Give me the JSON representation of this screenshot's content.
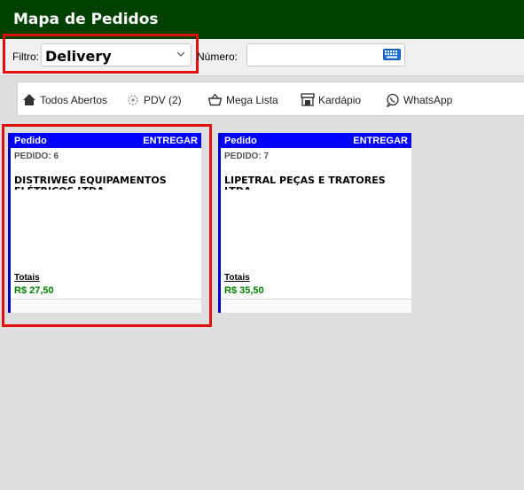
{
  "app": {
    "title": "Mapa de Pedidos"
  },
  "filter": {
    "label": "Filtro:",
    "value": "Delivery"
  },
  "numero": {
    "label": "Número:",
    "value": ""
  },
  "toolbar": {
    "todos_abertos": "Todos Abertos",
    "pdv": "PDV (2)",
    "mega_lista": "Mega Lista",
    "kardapio": "Kardápio",
    "whatsapp": "WhatsApp"
  },
  "orders": [
    {
      "header_left": "Pedido",
      "header_right": "ENTREGAR",
      "pedido": "PEDIDO: 6",
      "cliente": "DISTRIWEG EQUIPAMENTOS ELÉTRICOS LTDA",
      "totais_label": "Totais",
      "total": "R$ 27,50"
    },
    {
      "header_left": "Pedido",
      "header_right": "ENTREGAR",
      "pedido": "PEDIDO: 7",
      "cliente": "LIPETRAL PEÇAS E TRATORES LTDA",
      "totais_label": "Totais",
      "total": "R$ 35,50"
    }
  ],
  "colors": {
    "titlebar": "#004000",
    "card_header": "#0000ff",
    "highlight": "#e01010",
    "total": "#008000"
  }
}
